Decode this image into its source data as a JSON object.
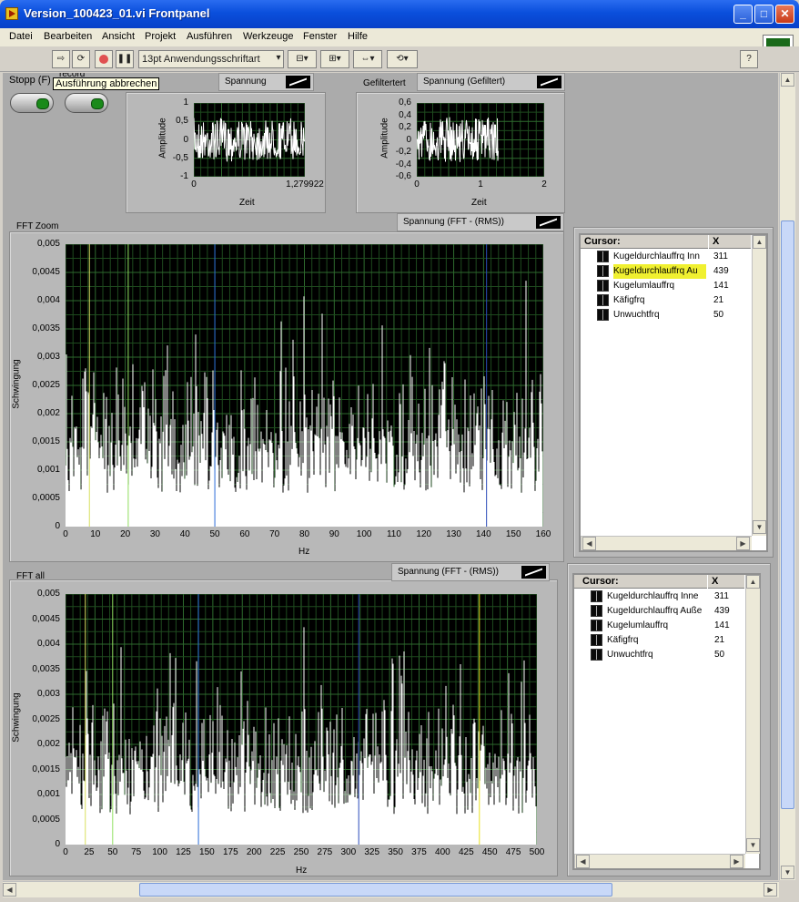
{
  "window": {
    "title": "Version_100423_01.vi Frontpanel",
    "min": "_",
    "max": "□",
    "close": "✕"
  },
  "menu": [
    "Datei",
    "Bearbeiten",
    "Ansicht",
    "Projekt",
    "Ausführen",
    "Werkzeuge",
    "Fenster",
    "Hilfe"
  ],
  "toolbar": {
    "font": "13pt Anwendungsschriftart",
    "help": "?"
  },
  "controls": {
    "stop_label": "Stopp (F)",
    "record_label": "record",
    "tooltip": "Ausführung abbrechen"
  },
  "graph1": {
    "legend": "Spannung",
    "ylabel": "Amplitude",
    "xlabel": "Zeit",
    "yticks": [
      "1",
      "0,5",
      "0",
      "-0,5",
      "-1"
    ],
    "xticks": [
      "0",
      "1,279922"
    ]
  },
  "graph2": {
    "caption": "Gefiltertert",
    "legend": "Spannung (Gefiltert)",
    "ylabel": "Amplitude",
    "xlabel": "Zeit",
    "yticks": [
      "0,6",
      "0,4",
      "0,2",
      "0",
      "-0,2",
      "-0,4",
      "-0,6"
    ],
    "xticks": [
      "0",
      "1",
      "2"
    ]
  },
  "fft_zoom": {
    "caption": "FFT Zoom",
    "legend": "Spannung (FFT - (RMS))",
    "ylabel": "Schwingung",
    "xlabel": "Hz",
    "yticks": [
      "0,005",
      "0,0045",
      "0,004",
      "0,0035",
      "0,003",
      "0,0025",
      "0,002",
      "0,0015",
      "0,001",
      "0,0005",
      "0"
    ],
    "xticks": [
      "0",
      "10",
      "20",
      "30",
      "40",
      "50",
      "60",
      "70",
      "80",
      "90",
      "100",
      "110",
      "120",
      "130",
      "140",
      "150",
      "160"
    ]
  },
  "fft_all": {
    "caption": "FFT all",
    "legend": "Spannung (FFT - (RMS))",
    "ylabel": "Schwingung",
    "xlabel": "Hz",
    "yticks": [
      "0,005",
      "0,0045",
      "0,004",
      "0,0035",
      "0,003",
      "0,0025",
      "0,002",
      "0,0015",
      "0,001",
      "0,0005",
      "0"
    ],
    "xticks": [
      "0",
      "25",
      "50",
      "75",
      "100",
      "125",
      "150",
      "175",
      "200",
      "225",
      "250",
      "275",
      "300",
      "325",
      "350",
      "375",
      "400",
      "425",
      "450",
      "475",
      "500"
    ]
  },
  "cursor1": {
    "header": "Cursor:",
    "xheader": "X",
    "rows": [
      {
        "name": "Kugeldurchlauffrq Inn",
        "x": "311"
      },
      {
        "name": "Kugeldurchlauffrq Au",
        "x": "439"
      },
      {
        "name": "Kugelumlauffrq",
        "x": "141"
      },
      {
        "name": "Käfigfrq",
        "x": "21"
      },
      {
        "name": "Unwuchtfrq",
        "x": "50"
      }
    ]
  },
  "cursor2": {
    "header": "Cursor:",
    "xheader": "X",
    "rows": [
      {
        "name": "Kugeldurchlauffrq Inne",
        "x": "311"
      },
      {
        "name": "Kugeldurchlauffrq Auße",
        "x": "439"
      },
      {
        "name": "Kugelumlauffrq",
        "x": "141"
      },
      {
        "name": "Käfigfrq",
        "x": "21"
      },
      {
        "name": "Unwuchtfrq",
        "x": "50"
      }
    ]
  },
  "chart_data": [
    {
      "type": "line",
      "title": "FFT Zoom",
      "xlabel": "Hz",
      "ylabel": "Schwingung",
      "xlim": [
        0,
        160
      ],
      "ylim": [
        0,
        0.005
      ],
      "series": [
        {
          "name": "Spannung (FFT - (RMS))"
        }
      ],
      "cursors": [
        8,
        21,
        50,
        141
      ],
      "grid": true
    },
    {
      "type": "line",
      "title": "FFT all",
      "xlabel": "Hz",
      "ylabel": "Schwingung",
      "xlim": [
        0,
        500
      ],
      "ylim": [
        0,
        0.005
      ],
      "series": [
        {
          "name": "Spannung (FFT - (RMS))"
        }
      ],
      "cursors": [
        21,
        50,
        141,
        311,
        439
      ],
      "grid": true
    }
  ]
}
